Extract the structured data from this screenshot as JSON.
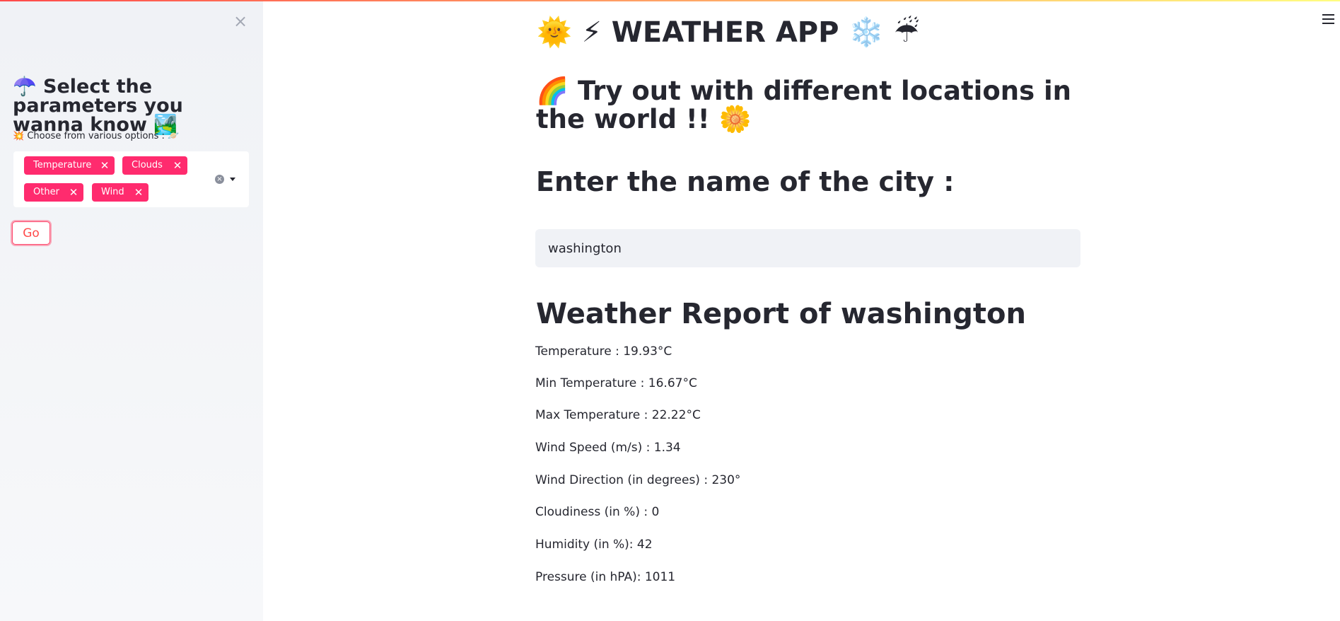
{
  "sidebar": {
    "close_label": "×",
    "title": "☂️ Select the parameters you wanna know 🏞️",
    "options_label": "💥 Choose from various options : 🪐",
    "selected_tags": [
      {
        "label": "Temperature",
        "remove": "✕"
      },
      {
        "label": "Clouds",
        "remove": "✕"
      },
      {
        "label": "Other",
        "remove": "✕"
      },
      {
        "label": "Wind",
        "remove": "✕"
      }
    ],
    "clear_label": "×",
    "go_label": "Go"
  },
  "main": {
    "title": "🌞 ⚡ WEATHER APP ❄️ ☔",
    "subtitle": "🌈 Try out with different locations in the world !! 🌼",
    "city_label": "Enter the name of the city :",
    "city_input_value": "washington",
    "report_heading": "Weather Report of washington",
    "report_lines": [
      "Temperature : 19.93°C",
      "Min Temperature : 16.67°C",
      "Max Temperature : 22.22°C",
      "Wind Speed (m/s) : 1.34",
      "Wind Direction (in degrees) : 230°",
      "Cloudiness (in %) : 0",
      "Humidity (in %): 42",
      "Pressure (in hPA): 1011"
    ]
  },
  "colors": {
    "accent": "#ff4b4b",
    "tag_background": "#ff2b6e",
    "sidebar_background": "#f0f2f6",
    "input_background": "#f0f2f6",
    "text": "#262730"
  },
  "icons": {
    "sidebar_close": "close-icon",
    "menu": "hamburger-menu-icon",
    "multiselect_clear": "clear-icon",
    "multiselect_dropdown": "chevron-down-icon"
  }
}
